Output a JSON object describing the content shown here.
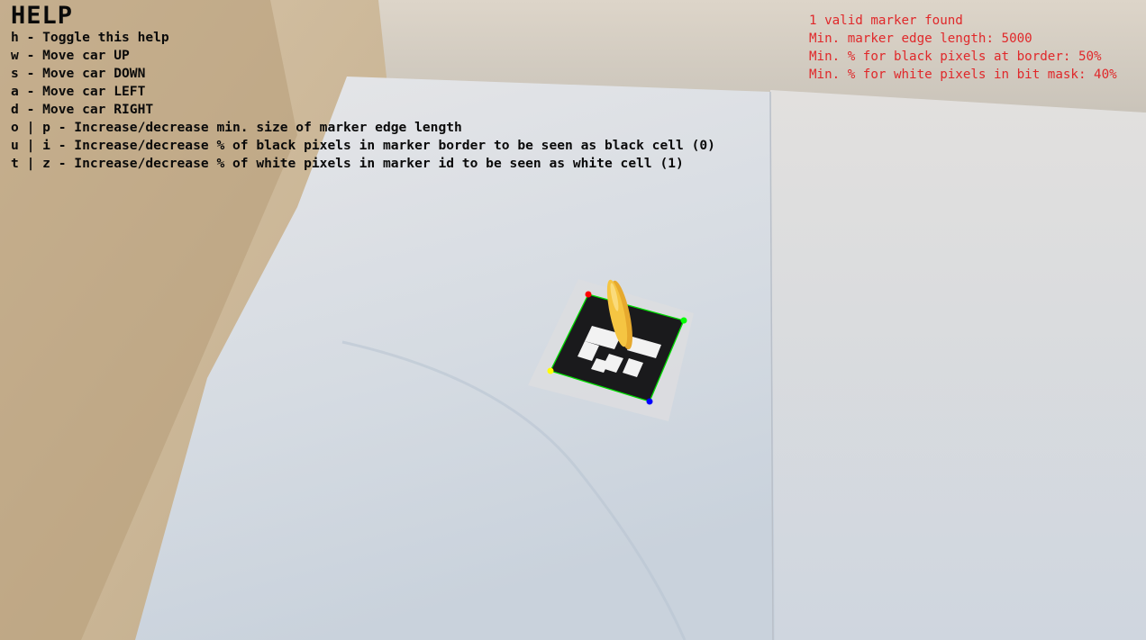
{
  "help": {
    "title": "HELP",
    "lines": [
      "h - Toggle this help",
      "w - Move car UP",
      "s - Move car DOWN",
      "a - Move car LEFT",
      "d - Move car RIGHT",
      "o | p - Increase/decrease min. size of marker edge length",
      "u | i - Increase/decrease % of black pixels in marker border to be seen as black cell (0)",
      "t | z - Increase/decrease % of white pixels in marker id to be seen as white cell (1)"
    ]
  },
  "status": {
    "lines": [
      "1 valid marker found",
      "Min. marker edge length: 5000",
      "Min. % for black pixels at border: 50%",
      "Min. % for white pixels in bit mask: 40%"
    ],
    "color": "#e0282a"
  },
  "marker": {
    "corner_colors": [
      "#ff0000",
      "#00ff00",
      "#0000ff",
      "#ffff00"
    ],
    "outline_color": "#00dd00"
  },
  "car": {
    "color": "#f5c542"
  }
}
